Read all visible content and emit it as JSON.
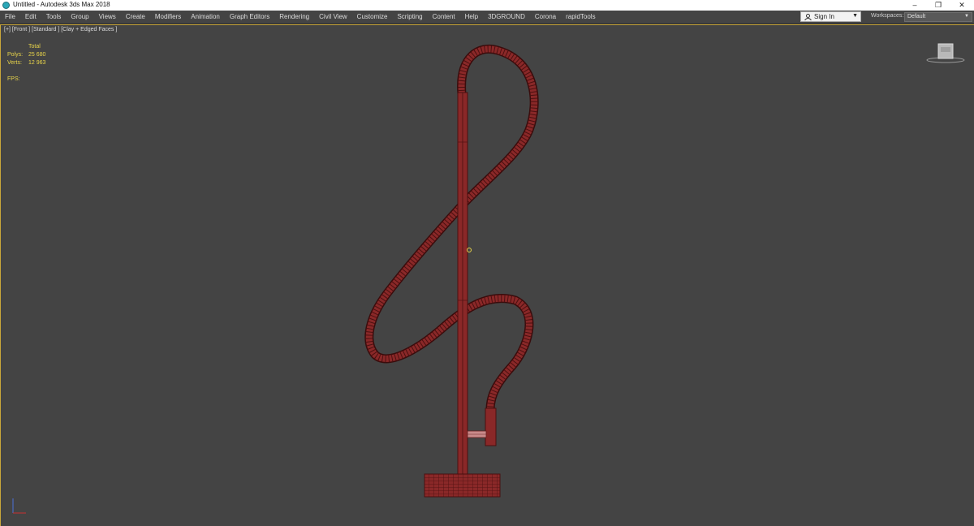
{
  "window": {
    "title": "Untitled - Autodesk 3ds Max 2018",
    "controls": [
      "–",
      "❐",
      "✕"
    ]
  },
  "menu": [
    "File",
    "Edit",
    "Tools",
    "Group",
    "Views",
    "Create",
    "Modifiers",
    "Animation",
    "Graph Editors",
    "Rendering",
    "Civil View",
    "Customize",
    "Scripting",
    "Content",
    "Help",
    "3DGROUND",
    "Corona",
    "rapidTools"
  ],
  "account": {
    "sign_in": "Sign In",
    "workspaces_label": "Workspaces:",
    "workspace_value": "Default"
  },
  "viewport": {
    "label": "[+] [Front ] [Standard ] [Clay + Edged Faces ]",
    "stats": {
      "total_label": "Total",
      "polys_label": "Polys:",
      "polys_value": "25 680",
      "verts_label": "Verts:",
      "verts_value": "12 963",
      "fps_label": "FPS:"
    }
  },
  "colors": {
    "model": "#8a2828",
    "wire": "#4a1010",
    "selection": "#c9a63a",
    "stats": "#e8d44a"
  },
  "icons": [
    "app-icon",
    "minimize-icon",
    "restore-icon",
    "close-icon",
    "user-icon",
    "chevron-down-icon",
    "viewcube-icon",
    "axis-gizmo-icon"
  ]
}
